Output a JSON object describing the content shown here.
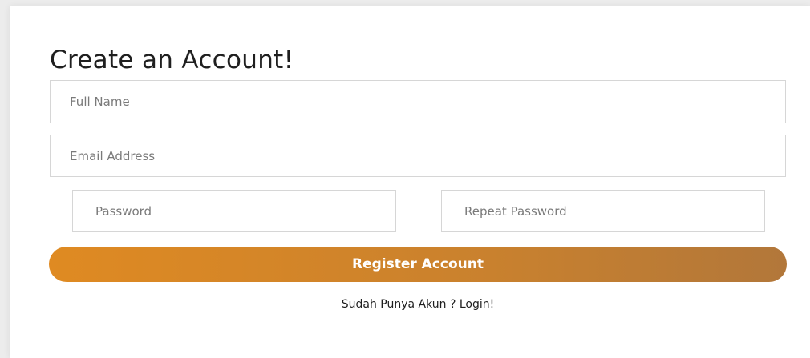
{
  "form": {
    "title": "Create an Account!",
    "full_name_placeholder": "Full Name",
    "email_placeholder": "Email Address",
    "password_placeholder": "Password",
    "repeat_password_placeholder": "Repeat Password",
    "register_label": "Register Account",
    "login_link": "Sudah Punya Akun ? Login!"
  },
  "colors": {
    "button_gradient_start": "#df8a22",
    "button_gradient_end": "#b2773a",
    "input_border": "#d6d6d6",
    "background": "#ececec"
  }
}
